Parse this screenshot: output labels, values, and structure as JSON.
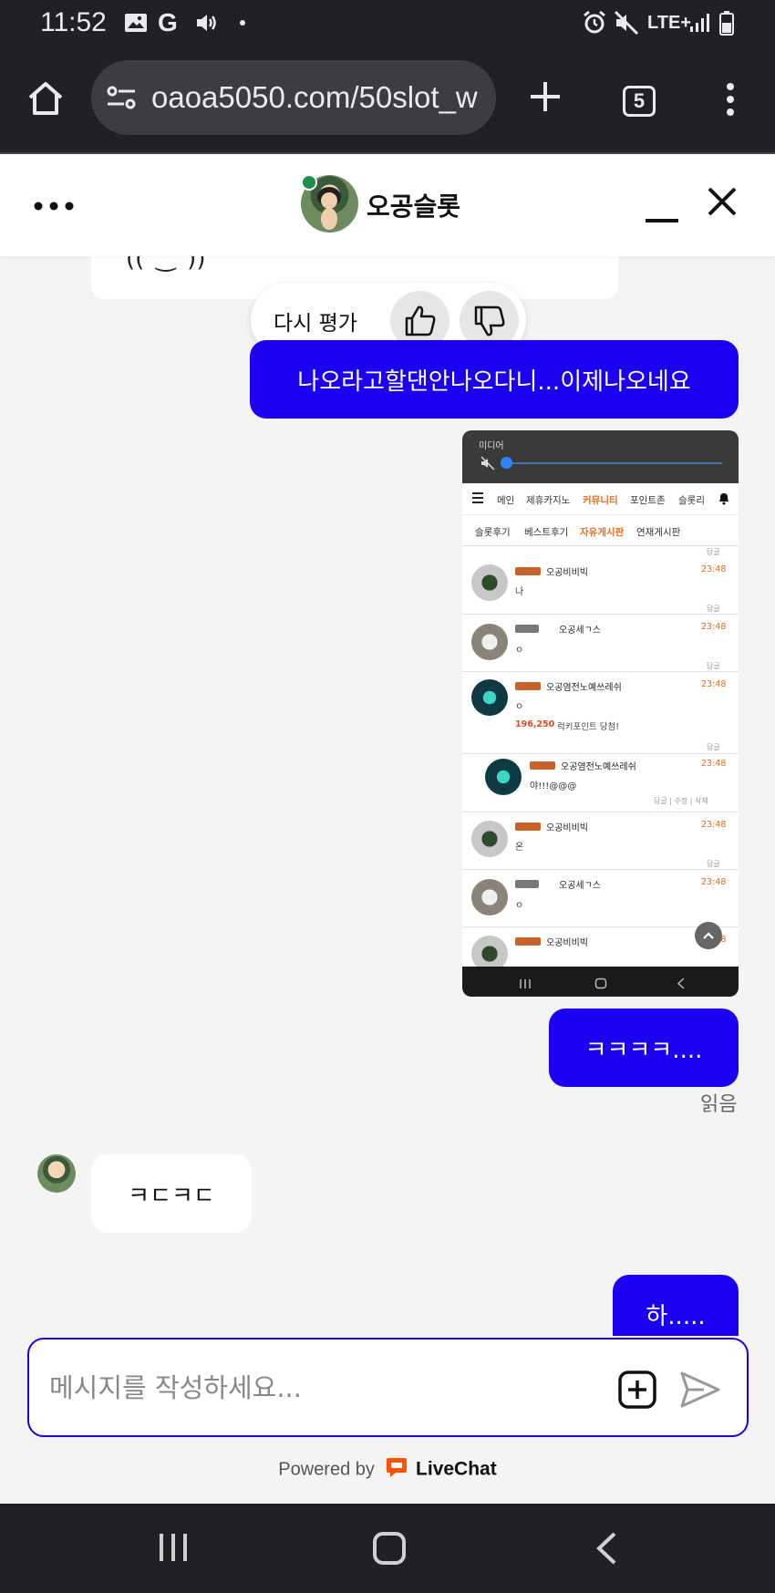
{
  "status_bar": {
    "time": "11:52",
    "network": "LTE+"
  },
  "browser": {
    "url": "oaoa5050.com/50slot_w",
    "tab_count": "5"
  },
  "chat_header": {
    "agent_name": "오공슬롯"
  },
  "previous_card": {
    "emoticon": "((´‿`))"
  },
  "rating": {
    "label": "다시 평가"
  },
  "messages": {
    "m1": "나오라고할댄안나오다니...이제나오네요",
    "m2": "ㅋㅋㅋㅋ....",
    "read_receipt": "읽음",
    "agent_reply": "ㅋㄷㅋㄷ",
    "m3": "하....."
  },
  "screenshot": {
    "media_label": "미디어",
    "nav1": [
      "메인",
      "제휴카지노",
      "커뮤니티",
      "포인트존",
      "슬롯리"
    ],
    "nav1_active": "커뮤니티",
    "nav2": [
      "슬롯후기",
      "베스트후기",
      "자유게시판",
      "연재게시판"
    ],
    "nav2_active": "자유게시판",
    "comments": [
      {
        "name": "오공비비빅",
        "time": "23:48",
        "body": "나",
        "reply": "답글"
      },
      {
        "name": "오공세ㄱ스",
        "time": "23:48",
        "body": "ㅇ",
        "reply": "답글"
      },
      {
        "name": "오공염전노예쓰레쉬",
        "time": "23:48",
        "body": "ㅇ",
        "points_value": "196,250",
        "points_text": "럭키포인트 당첨!",
        "reply": "답글"
      },
      {
        "name": "오공염전노예쓰레쉬",
        "time": "23:48",
        "body": "야!!!@@@",
        "actions": "답글 | 수정 | 삭제"
      },
      {
        "name": "오공비비빅",
        "time": "23:48",
        "body": "온",
        "reply": "답글"
      },
      {
        "name": "오공세ㄱ스",
        "time": "23:48",
        "body": "ㅇ"
      },
      {
        "name": "오공비비빅",
        "time": "23:48",
        "body": ""
      }
    ],
    "top_reply": "답글"
  },
  "composer": {
    "placeholder": "메시지를 작성하세요..."
  },
  "footer": {
    "powered_by": "Powered by",
    "brand": "LiveChat"
  },
  "colors": {
    "accent": "#1c00f2",
    "livechat_orange": "#ff5100",
    "online": "#1f8f4e"
  }
}
